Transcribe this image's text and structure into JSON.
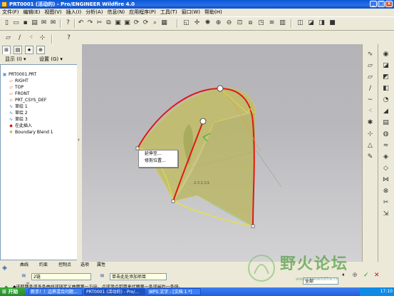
{
  "window": {
    "title": "PRT0001 (活动的) - Pro/ENGINEER Wildfire 4.0"
  },
  "menu": [
    "文件(F)",
    "编辑(E)",
    "视图(V)",
    "插入(I)",
    "分析(A)",
    "信息(N)",
    "应用程序(P)",
    "工具(T)",
    "窗口(W)",
    "帮助(H)"
  ],
  "nav": {
    "show_label": "显示 (I) ▾",
    "settings_label": "设置 (G) ▾",
    "tree": [
      {
        "label": "PRT0001.PRT",
        "icon": "part-icon"
      },
      {
        "label": "RIGHT",
        "icon": "datum-plane-icon"
      },
      {
        "label": "TOP",
        "icon": "datum-plane-icon"
      },
      {
        "label": "FRONT",
        "icon": "datum-plane-icon"
      },
      {
        "label": "PRT_CSYS_DEF",
        "icon": "csys-icon"
      },
      {
        "label": "草绘 1",
        "icon": "sketch-icon"
      },
      {
        "label": "草绘 2",
        "icon": "sketch-icon"
      },
      {
        "label": "草绘 3",
        "icon": "sketch-icon"
      },
      {
        "label": "在此插入",
        "icon": "insert-here-icon"
      },
      {
        "label": "Boundary Blend 1",
        "icon": "boundary-blend-icon"
      }
    ]
  },
  "context_menu": [
    "延伸至...",
    "修剪位置..."
  ],
  "dashboard": {
    "tabs": [
      "曲线",
      "约束",
      "控制点",
      "选项",
      "属性"
    ],
    "first_dir_value": "2链",
    "second_dir_value": "单击此处添加项目",
    "message": "◆选取两条或多条曲线或链定义曲面第一方向。点或顶点可用来代替第一条或最后一条链。"
  },
  "viewport": {
    "annotation": "2.3 2.1/1"
  },
  "taskbar": {
    "start_label": "开始",
    "tasks": [
      "新手！！边界混合问题...",
      "PRT0001 (活动的) - Pro/...",
      "WPS 文字 - [文档 1 *]"
    ],
    "clock": "17:10"
  },
  "watermark": {
    "title": "野火论坛",
    "url": "www.proewildfire.cn"
  },
  "status": {
    "filter_value": "全部"
  },
  "colors": {
    "surface": "#b9b45a",
    "curve_red": "#e01818",
    "curve_yellow": "#e8e23a",
    "titlebar": "#0a58d8"
  }
}
